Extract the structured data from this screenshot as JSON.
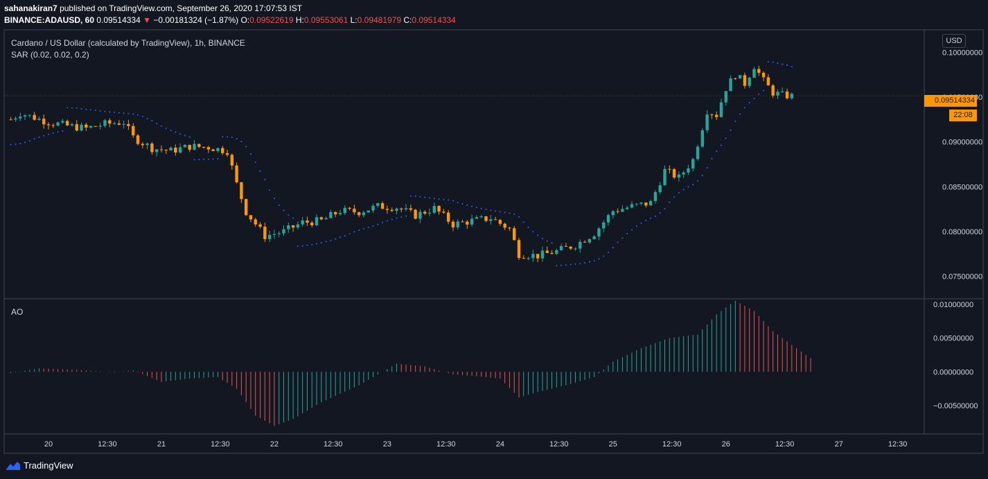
{
  "header": {
    "publisher": "sahanakiran7",
    "published_text": "published on TradingView.com, September 26, 2020 17:07:53 IST",
    "symbol": "BINANCE:ADAUSD, 60",
    "last": "0.09514334",
    "change": "−0.00181324 (−1.87%)",
    "o_label": "O:",
    "o": "0.09522619",
    "h_label": "H:",
    "h": "0.09553061",
    "l_label": "L:",
    "l": "0.09481979",
    "c_label": "C:",
    "c": "0.09514334"
  },
  "pane_main": {
    "title": "Cardano / US Dollar (calculated by TradingView), 1h, BINANCE",
    "indicator": "SAR (0.02, 0.02, 0.2)",
    "currency_button": "USD",
    "price_tag": "0.09514334",
    "countdown_tag": "22:08"
  },
  "pane_ao": {
    "title": "AO"
  },
  "branding": {
    "name": "TradingView"
  },
  "colors": {
    "up": "#26a69a",
    "down": "#ff9800",
    "sar": "#2962ff",
    "ao_up": "#26a69a",
    "ao_down": "#ef5350",
    "bg": "#131722"
  },
  "chart_data": [
    {
      "type": "candlestick",
      "title": "Cardano / US Dollar (calculated by TradingView), 1h, BINANCE",
      "y_ticks": [
        0.075,
        0.08,
        0.085,
        0.09,
        0.095,
        0.1
      ],
      "y_tick_labels": [
        "0.07500000",
        "0.08000000",
        "0.08500000",
        "0.09000000",
        "0.09500000",
        "0.10000000"
      ],
      "ylim": [
        0.0725,
        0.1025
      ],
      "x_tick_labels": [
        "20",
        "12:30",
        "21",
        "12:30",
        "22",
        "12:30",
        "23",
        "12:30",
        "24",
        "12:30",
        "25",
        "12:30",
        "26",
        "12:30",
        "27",
        "12:30"
      ],
      "x_tick_hours": [
        0,
        12.5,
        24,
        36.5,
        48,
        60.5,
        72,
        84.5,
        96,
        108.5,
        120,
        132.5,
        144,
        156.5,
        168,
        180.5
      ],
      "series_close_hourly_keypoints": [
        {
          "hour": -8,
          "value": 0.0925
        },
        {
          "hour": -6,
          "value": 0.0932
        },
        {
          "hour": -3,
          "value": 0.0927
        },
        {
          "hour": 0,
          "value": 0.0922
        },
        {
          "hour": 4,
          "value": 0.0918
        },
        {
          "hour": 8,
          "value": 0.0915
        },
        {
          "hour": 12,
          "value": 0.092
        },
        {
          "hour": 16,
          "value": 0.0922
        },
        {
          "hour": 18,
          "value": 0.0905
        },
        {
          "hour": 22,
          "value": 0.0893
        },
        {
          "hour": 26,
          "value": 0.089
        },
        {
          "hour": 30,
          "value": 0.0895
        },
        {
          "hour": 34,
          "value": 0.0894
        },
        {
          "hour": 38,
          "value": 0.089
        },
        {
          "hour": 40,
          "value": 0.0853
        },
        {
          "hour": 42,
          "value": 0.0822
        },
        {
          "hour": 46,
          "value": 0.0795
        },
        {
          "hour": 50,
          "value": 0.08
        },
        {
          "hour": 54,
          "value": 0.081
        },
        {
          "hour": 58,
          "value": 0.0812
        },
        {
          "hour": 62,
          "value": 0.0823
        },
        {
          "hour": 66,
          "value": 0.0822
        },
        {
          "hour": 70,
          "value": 0.0828
        },
        {
          "hour": 74,
          "value": 0.0827
        },
        {
          "hour": 78,
          "value": 0.0818
        },
        {
          "hour": 82,
          "value": 0.0826
        },
        {
          "hour": 86,
          "value": 0.0808
        },
        {
          "hour": 90,
          "value": 0.0812
        },
        {
          "hour": 94,
          "value": 0.0815
        },
        {
          "hour": 98,
          "value": 0.0803
        },
        {
          "hour": 100,
          "value": 0.0775
        },
        {
          "hour": 104,
          "value": 0.0773
        },
        {
          "hour": 108,
          "value": 0.0778
        },
        {
          "hour": 112,
          "value": 0.0785
        },
        {
          "hour": 116,
          "value": 0.0798
        },
        {
          "hour": 120,
          "value": 0.0823
        },
        {
          "hour": 124,
          "value": 0.0828
        },
        {
          "hour": 128,
          "value": 0.0832
        },
        {
          "hour": 131,
          "value": 0.0868
        },
        {
          "hour": 134,
          "value": 0.086
        },
        {
          "hour": 137,
          "value": 0.088
        },
        {
          "hour": 140,
          "value": 0.0935
        },
        {
          "hour": 142,
          "value": 0.093
        },
        {
          "hour": 144,
          "value": 0.096
        },
        {
          "hour": 146,
          "value": 0.0975
        },
        {
          "hour": 148,
          "value": 0.0965
        },
        {
          "hour": 150,
          "value": 0.0985
        },
        {
          "hour": 152,
          "value": 0.0968
        },
        {
          "hour": 154,
          "value": 0.0955
        },
        {
          "hour": 156,
          "value": 0.0952
        },
        {
          "hour": 158,
          "value": 0.0951
        }
      ]
    },
    {
      "type": "bar",
      "title": "AO",
      "y_ticks": [
        -0.005,
        0,
        0.005,
        0.01
      ],
      "y_tick_labels": [
        "−0.00500000",
        "0.00000000",
        "0.00500000",
        "0.01000000"
      ],
      "ylim": [
        -0.0092,
        0.0108
      ],
      "keypoints": [
        {
          "hour": -8,
          "value": -0.0002
        },
        {
          "hour": -2,
          "value": 0.0005
        },
        {
          "hour": 6,
          "value": 0.0003
        },
        {
          "hour": 14,
          "value": -0.0001
        },
        {
          "hour": 18,
          "value": 0.0002
        },
        {
          "hour": 24,
          "value": -0.0015
        },
        {
          "hour": 30,
          "value": -0.001
        },
        {
          "hour": 36,
          "value": -0.0008
        },
        {
          "hour": 40,
          "value": -0.0025
        },
        {
          "hour": 44,
          "value": -0.0065
        },
        {
          "hour": 48,
          "value": -0.008
        },
        {
          "hour": 52,
          "value": -0.007
        },
        {
          "hour": 58,
          "value": -0.0045
        },
        {
          "hour": 66,
          "value": -0.002
        },
        {
          "hour": 74,
          "value": 0.0012
        },
        {
          "hour": 80,
          "value": 0.0008
        },
        {
          "hour": 86,
          "value": -0.0004
        },
        {
          "hour": 90,
          "value": -0.0006
        },
        {
          "hour": 96,
          "value": -0.001
        },
        {
          "hour": 100,
          "value": -0.0038
        },
        {
          "hour": 104,
          "value": -0.003
        },
        {
          "hour": 110,
          "value": -0.002
        },
        {
          "hour": 116,
          "value": -0.0008
        },
        {
          "hour": 120,
          "value": 0.0015
        },
        {
          "hour": 126,
          "value": 0.0035
        },
        {
          "hour": 132,
          "value": 0.005
        },
        {
          "hour": 138,
          "value": 0.0055
        },
        {
          "hour": 142,
          "value": 0.0085
        },
        {
          "hour": 146,
          "value": 0.0105
        },
        {
          "hour": 150,
          "value": 0.009
        },
        {
          "hour": 154,
          "value": 0.006
        },
        {
          "hour": 158,
          "value": 0.004
        },
        {
          "hour": 162,
          "value": 0.002
        }
      ]
    }
  ]
}
